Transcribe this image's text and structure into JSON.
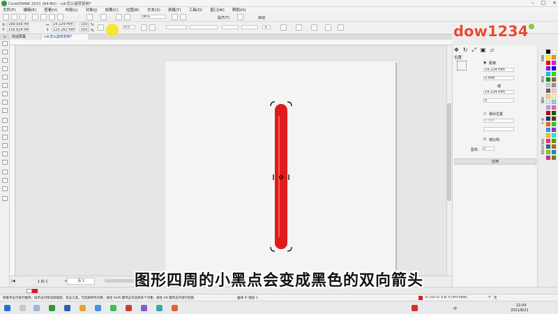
{
  "window": {
    "title": "CorelDRAW 2021 (64-Bit) - cdr怎么旋转复制*"
  },
  "menu": [
    "文件(F)",
    "编辑(E)",
    "查看(V)",
    "布局(L)",
    "对象(J)",
    "效果(C)",
    "位图(B)",
    "文本(X)",
    "表格(T)",
    "工具(O)",
    "窗口(W)",
    "帮助(H)"
  ],
  "toolbar": {
    "zoom": "36%",
    "snap_label": "贴齐(T)",
    "launch_label": "启动"
  },
  "propbar": {
    "x_label": "X:",
    "x_value": "189.956 mm",
    "y_label": "Y:",
    "y_value": "156.624 mm",
    "w_value": "14.224 mm",
    "h_value": "125.262 mm",
    "sx_value": "100.0",
    "sy_value": "100.0",
    "pct": "%",
    "rotation": "0.0",
    "outline_width": ".5"
  },
  "tabs": {
    "welcome": "欢迎屏幕",
    "doc": "cdr怎么旋转复制*"
  },
  "page_nav": {
    "page_counter": "1 的 1",
    "page_tab": "页 1"
  },
  "docker": {
    "title": "位置",
    "distance_label": "距离",
    "h_value": "14.224 mm",
    "v_value": "0 mm",
    "or_label": "或",
    "dist_value": "14.224 mm",
    "angle_value": "0",
    "relative_label": "相对位置",
    "rel_value": "0 mm",
    "proportional_label": "按比例",
    "copies_label": "副本:",
    "copies_value": "2",
    "apply_label": "应用"
  },
  "docker_tabs": [
    "属性",
    "对象",
    "变换",
    "导入",
    "对齐与分布"
  ],
  "status": {
    "hint": "接着单击可进行推移；再单击可拖动或缩放；双击工具，可选择所有对象；按住 Shift 键单击可选择多个对象；按住 Alt 键单击可进行挖掘",
    "layer": "曲线 于 图层 1",
    "fill": "R: 255 G: 0 B: 0 (#FF0000)",
    "outline": "无"
  },
  "taskbar": {
    "time": "22:04",
    "date": "2021/8/21",
    "lang": "中"
  },
  "logo": {
    "text": "dow1234"
  },
  "subtitle": {
    "text": "图形四周的小黑点会变成黑色的双向箭头"
  },
  "colors": {
    "accent_red": "#e01b1b",
    "selection": "#000000",
    "logo_red": "#e64a2e",
    "logo_green": "#8dc63f"
  },
  "palette": [
    "#000000",
    "#ffffff",
    "#ffff00",
    "#ff9900",
    "#ff0000",
    "#ff00ff",
    "#9900ff",
    "#0000ff",
    "#00ccff",
    "#00ff00",
    "#009900",
    "#996633",
    "#cccccc",
    "#999999",
    "#666666",
    "#ffcccc",
    "#ffcc99",
    "#ffff99",
    "#ccffcc",
    "#99ccff",
    "#cc99ff",
    "#ff6699",
    "#cc0000",
    "#006600",
    "#003399",
    "#663300",
    "#ff6600",
    "#33cc33",
    "#3399ff",
    "#9933cc",
    "#ffcc00",
    "#00ffcc",
    "#ff3366",
    "#669900",
    "#336699",
    "#cc6600",
    "#99cc00",
    "#0099cc",
    "#cc3399",
    "#808000"
  ]
}
